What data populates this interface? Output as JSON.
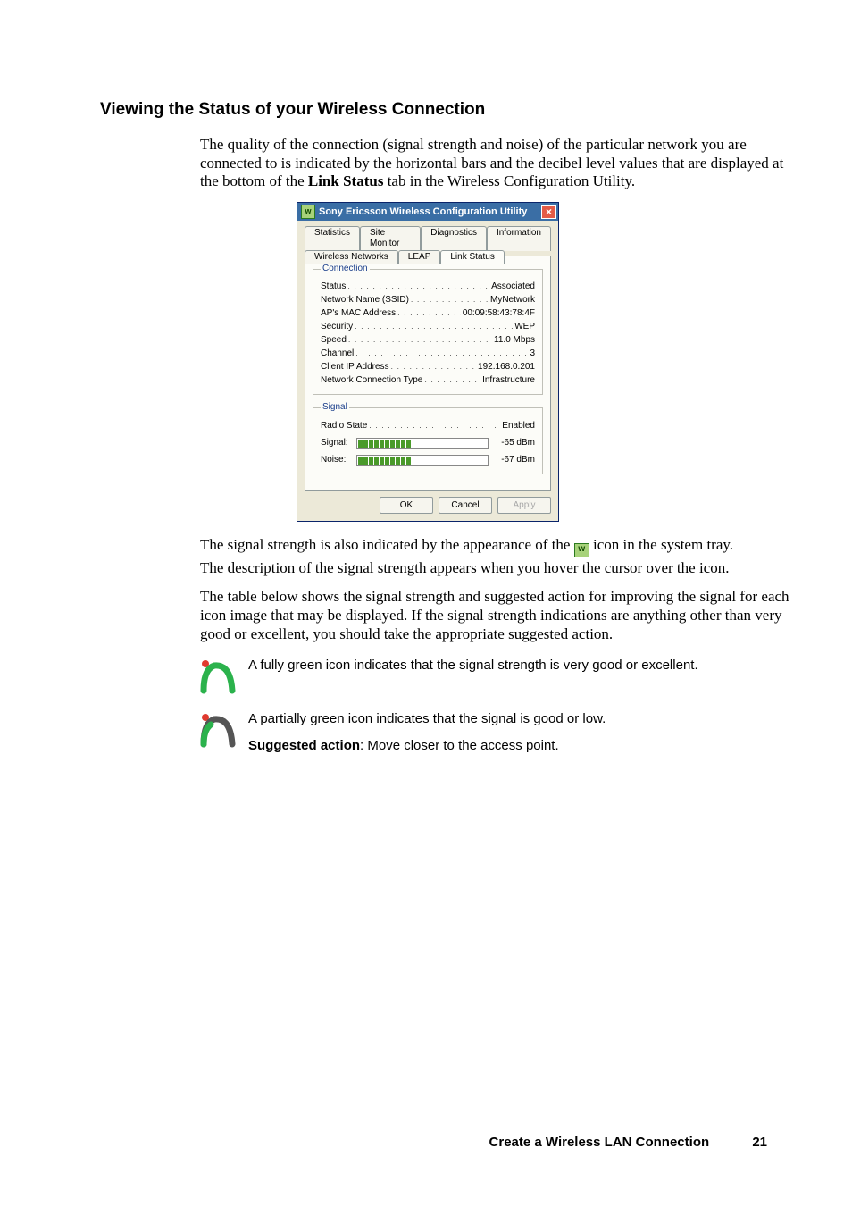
{
  "heading": "Viewing the Status of your Wireless Connection",
  "para1": "The quality of the connection (signal strength and noise) of the particular network you are connected to is indicated by the horizontal bars and the decibel level values that are displayed at the bottom of the ",
  "para1_bold": "Link Status",
  "para1_tail": " tab in the Wireless Configuration Utility.",
  "para2a": "The signal strength is also indicated by the appearance of the ",
  "para2b": " icon in the system tray.",
  "para3": "The description of the signal strength appears when you hover the cursor over the icon.",
  "para4": "The table below shows the signal strength and suggested action for improving the signal for each icon image that may be displayed. If the signal strength indications are anything other than very good or excellent, you should take the appropriate suggested action.",
  "dialog": {
    "title": "Sony Ericsson Wireless Configuration Utility",
    "close_glyph": "×",
    "app_icon_glyph": "w",
    "tabs_row1": [
      "Statistics",
      "Site Monitor",
      "Diagnostics",
      "Information"
    ],
    "tabs_row2": [
      "Wireless Networks",
      "LEAP",
      "Link Status"
    ],
    "active_tab": "Link Status",
    "connection_legend": "Connection",
    "signal_legend": "Signal",
    "conn": [
      {
        "k": "Status",
        "v": "Associated"
      },
      {
        "k": "Network Name (SSID)",
        "v": "MyNetwork"
      },
      {
        "k": "AP's MAC Address",
        "v": "00:09:58:43:78:4F"
      },
      {
        "k": "Security",
        "v": "WEP"
      },
      {
        "k": "Speed",
        "v": "11.0 Mbps"
      },
      {
        "k": "Channel",
        "v": "3"
      },
      {
        "k": "Client IP Address",
        "v": "192.168.0.201"
      },
      {
        "k": "Network Connection Type",
        "v": "Infrastructure"
      }
    ],
    "radio_state": {
      "k": "Radio State",
      "v": "Enabled"
    },
    "signal": {
      "label": "Signal:",
      "filled": 10,
      "total": 24,
      "value": "-65 dBm"
    },
    "noise": {
      "label": "Noise:",
      "filled": 10,
      "total": 24,
      "value": "-67 dBm"
    },
    "buttons": {
      "ok": "OK",
      "cancel": "Cancel",
      "apply": "Apply"
    }
  },
  "tray_icon_glyph": "w",
  "icons": [
    {
      "kind": "full",
      "text": "A fully green icon indicates that the signal strength is very good or excellent."
    },
    {
      "kind": "partial",
      "text": "A partially green icon indicates that the signal is good or low.",
      "suggested_label": "Suggested action",
      "suggested_text": ": Move closer to the access point."
    }
  ],
  "footer": {
    "title": "Create a Wireless LAN Connection",
    "page": "21"
  }
}
